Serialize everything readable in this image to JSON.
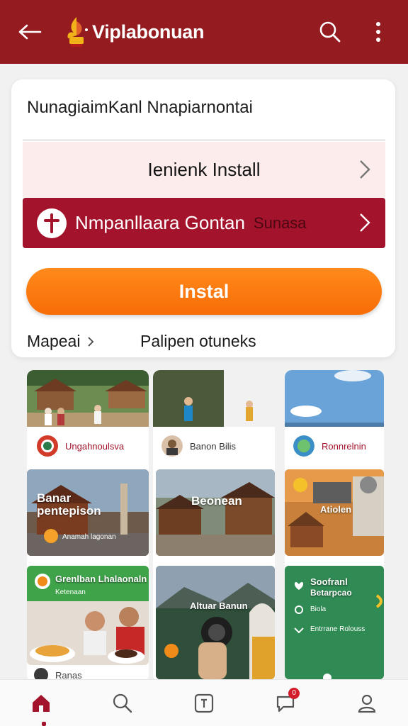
{
  "appbar": {
    "title": "Viplabonuan",
    "back_icon": "arrow-left-icon",
    "search_icon": "search-icon",
    "menu_icon": "more-vertical-icon"
  },
  "card": {
    "heading": "NunagiaimKanl Nnapiarnontai",
    "install_row": {
      "label": "Ienienk Install"
    },
    "feature_row": {
      "label": "Nmpanllaara Gontan",
      "sub": "Sunasa"
    },
    "install_button": "Instal",
    "meta_left": "Mapeai",
    "meta_right": "Palipen otuneks"
  },
  "grid": {
    "col1": {
      "chip": "Ungahnoulsva",
      "tile1": {
        "title": "Banar",
        "subtitle": "pentepison",
        "caption": "Anamah lagonan"
      },
      "tile2": {
        "title": "Grenlban Lhalaonaln",
        "subtitle": "Ketenaan"
      },
      "footer": "Ranas"
    },
    "col2": {
      "chip": "Banon Bilis",
      "tile1": {
        "title": "Beonean"
      },
      "tile2": {
        "title": "Altuar Banun"
      }
    },
    "col3": {
      "chip": "Ronnrelnin",
      "tile1": {
        "title": "Atiolen"
      },
      "tile2": {
        "title": "Soofranl",
        "subtitle": "Betarpcao",
        "item1": "Biola",
        "item2": "Entrrane Rolouss"
      }
    }
  },
  "bottom_nav": {
    "items": [
      {
        "name": "home",
        "icon": "home-icon",
        "active": true
      },
      {
        "name": "search",
        "icon": "search-icon"
      },
      {
        "name": "apps",
        "icon": "square-tile-icon"
      },
      {
        "name": "messages",
        "icon": "chat-icon",
        "badge": "0"
      },
      {
        "name": "profile",
        "icon": "user-icon"
      }
    ]
  },
  "colors": {
    "brand": "#941b20",
    "accent_red": "#a3132b",
    "accent_orange": "#f87a10",
    "pink_row": "#fdecec"
  }
}
